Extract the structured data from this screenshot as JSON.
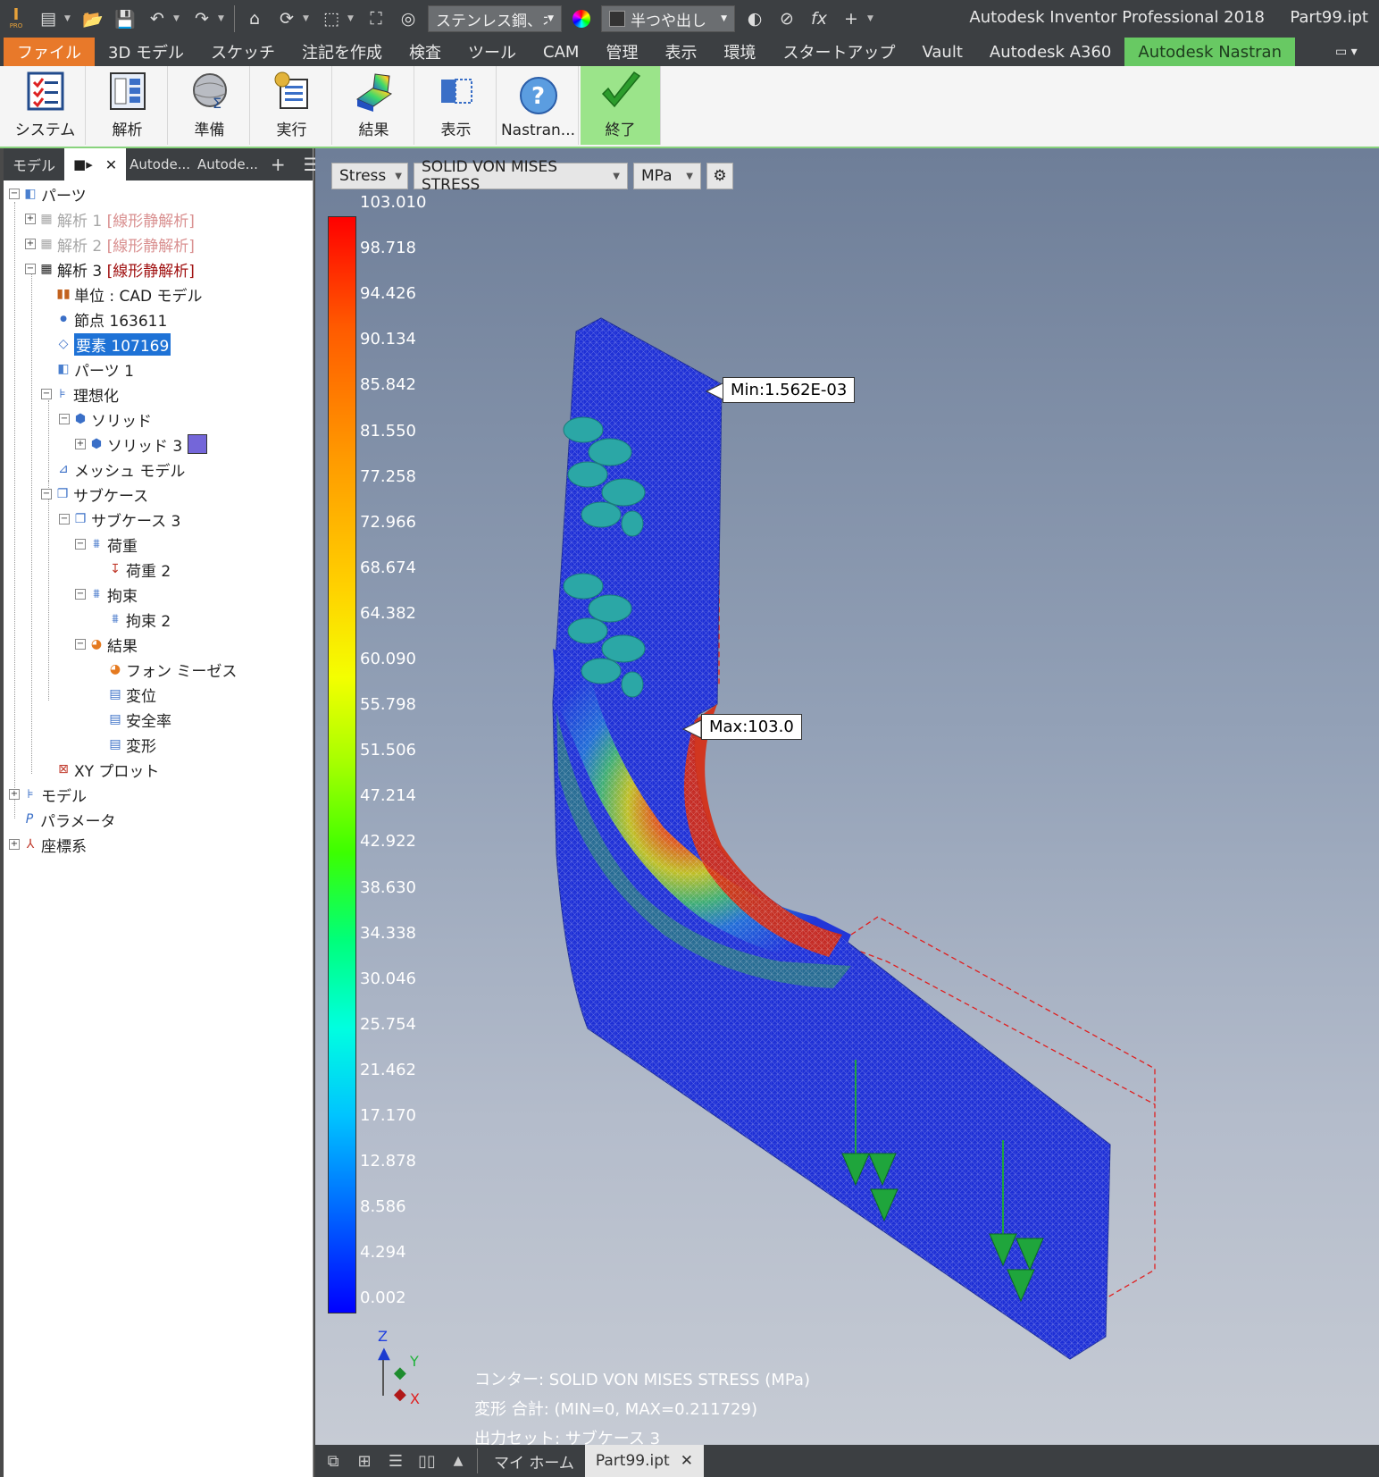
{
  "app": {
    "title": "Autodesk Inventor Professional 2018",
    "file": "Part99.ipt",
    "logo_label": "PRO"
  },
  "quick_access": {
    "material": "ステンレス鋼、オ",
    "appearance": "半つや出し",
    "fx": "fx"
  },
  "tabs": [
    "ファイル",
    "3D モデル",
    "スケッチ",
    "注記を作成",
    "検査",
    "ツール",
    "CAM",
    "管理",
    "表示",
    "環境",
    "スタートアップ",
    "Vault",
    "Autodesk A360",
    "Autodesk Nastran"
  ],
  "ribbon": {
    "system": "システム",
    "analysis": "解析",
    "prepare": "準備",
    "run": "実行",
    "results": "結果",
    "display": "表示",
    "nastran": "Nastran...",
    "finish": "終了"
  },
  "browser": {
    "tab_model": "モデル",
    "tab_autodesk1": "Autode...",
    "tab_autodesk2": "Autode...",
    "tree": {
      "parts": "パーツ",
      "analysis1": "解析 1",
      "analysis1_type": "[線形静解析]",
      "analysis2": "解析 2",
      "analysis2_type": "[線形静解析]",
      "analysis3": "解析 3",
      "analysis3_type": "[線形静解析]",
      "units": "単位 : CAD モデル",
      "nodes": "節点 163611",
      "elements": "要素 107169",
      "part1": "パーツ 1",
      "idealization": "理想化",
      "solid": "ソリッド",
      "solid3": "ソリッド 3",
      "mesh_model": "メッシュ モデル",
      "subcases": "サブケース",
      "subcase3": "サブケース 3",
      "loads": "荷重",
      "load2": "荷重 2",
      "constraints": "拘束",
      "constraint2": "拘束 2",
      "results": "結果",
      "von_mises": "フォン ミーゼス",
      "displacement": "変位",
      "safety_factor": "安全率",
      "deformation": "変形",
      "xy_plot": "XY プロット",
      "model": "モデル",
      "parameters": "パラメータ",
      "coord_system": "座標系"
    }
  },
  "viewport": {
    "result_type": "Stress",
    "component": "SOLID VON MISES STRESS",
    "unit": "MPa",
    "legend_values": [
      "103.010",
      "98.718",
      "94.426",
      "90.134",
      "85.842",
      "81.550",
      "77.258",
      "72.966",
      "68.674",
      "64.382",
      "60.090",
      "55.798",
      "51.506",
      "47.214",
      "42.922",
      "38.630",
      "34.338",
      "30.046",
      "25.754",
      "21.462",
      "17.170",
      "12.878",
      "8.586",
      "4.294",
      "0.002"
    ],
    "min_label": "Min:1.562E-03",
    "max_label": "Max:103.0",
    "axis_z": "Z",
    "axis_y": "Y",
    "axis_x": "X",
    "info": {
      "contour": "コンター: SOLID VON MISES STRESS (MPa)",
      "deform": "変形 合計: (MIN=0, MAX=0.211729)",
      "output": "出力セット: サブケース 3"
    }
  },
  "doc_tabs": {
    "home": "マイ ホーム",
    "file": "Part99.ipt"
  }
}
